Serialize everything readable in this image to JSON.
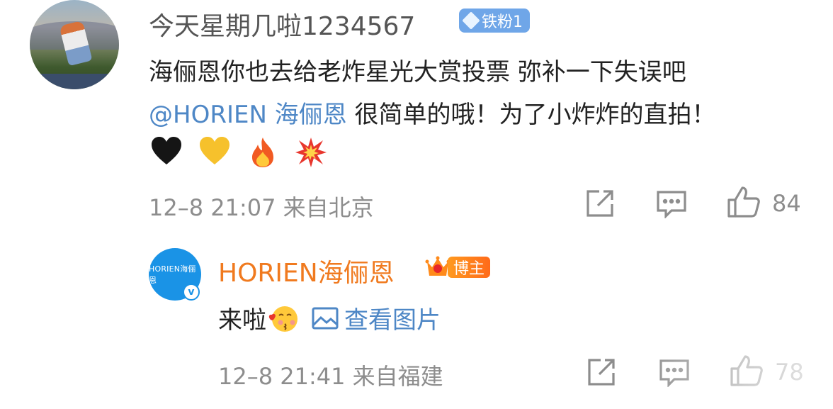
{
  "comment1": {
    "username": "今天星期几啦1234567",
    "badge_label": "铁粉1",
    "text_line1": "海俪恩你也去给老炸星光大赏投票 弥补一下失误吧",
    "mention": "@HORIEN 海俪恩",
    "text_line2_rest": " 很简单的哦！为了小炸炸的直拍！",
    "emojis": [
      "black-heart",
      "yellow-heart",
      "fire",
      "collision"
    ],
    "meta": "12–8 21:07 来自北京",
    "like_count": "84"
  },
  "comment2": {
    "username": "HORIEN海俪恩",
    "avatar_text": "HORIEN海俪恩",
    "verified_mark": "v",
    "badge_label": "博主",
    "text": "来啦",
    "view_image_label": "查看图片",
    "meta": "12–8 21:41 来自福建",
    "like_count": "78"
  },
  "colors": {
    "mention_blue": "#4e87c6",
    "blogger_orange": "#f07a1f",
    "meta_gray": "#8d8d8d",
    "fan_badge_blue": "#6fa6e8"
  }
}
